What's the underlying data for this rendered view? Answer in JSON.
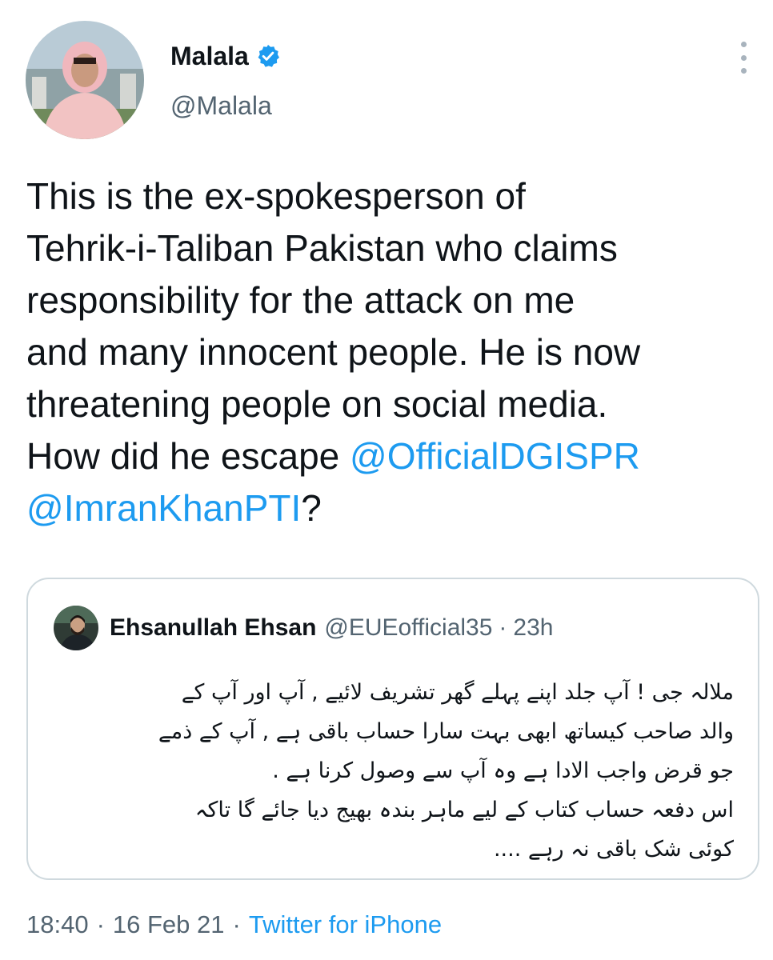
{
  "author": {
    "display_name": "Malala",
    "handle": "@Malala",
    "verified": true,
    "avatar_icon": "profile-photo"
  },
  "menu_icon": "more-vertical-icon",
  "tweet": {
    "text_lines": [
      "This is the ex-spokesperson of",
      "Tehrik-i-Taliban Pakistan who claims",
      "responsibility for the attack on me",
      "and many innocent people. He is now",
      "threatening people on social media.",
      "How did he escape "
    ],
    "mention_1": "@OfficialDGISPR",
    "mention_2": "@ImranKhanPTI",
    "ending": "?"
  },
  "quoted_tweet": {
    "display_name": "Ehsanullah Ehsan",
    "handle": "@EUEofficial35",
    "separator": "·",
    "time": "23h",
    "lines": [
      "ملالہ جی ! آپ جلد اپنے پہلے گھر تشریف لائیے , آپ اور آپ کے",
      "والد صاحب کیساتھ ابھی بہت سارا حساب باقی ہے , آپ کے ذمے",
      "جو قرض واجب الادا ہے وہ آپ سے وصول کرنا ہے .",
      "اس دفعہ حساب کتاب کے لیے ماہر بندہ بھیج دیا جائے گا تاکہ",
      "کوئی شک باقی نہ رہے ...."
    ]
  },
  "meta": {
    "time": "18:40",
    "separator": "·",
    "date": "16 Feb 21",
    "source": "Twitter for iPhone"
  },
  "colors": {
    "link": "#1d9bf0",
    "secondary": "#536471",
    "text": "#0f1419",
    "border": "#cfd9de"
  }
}
